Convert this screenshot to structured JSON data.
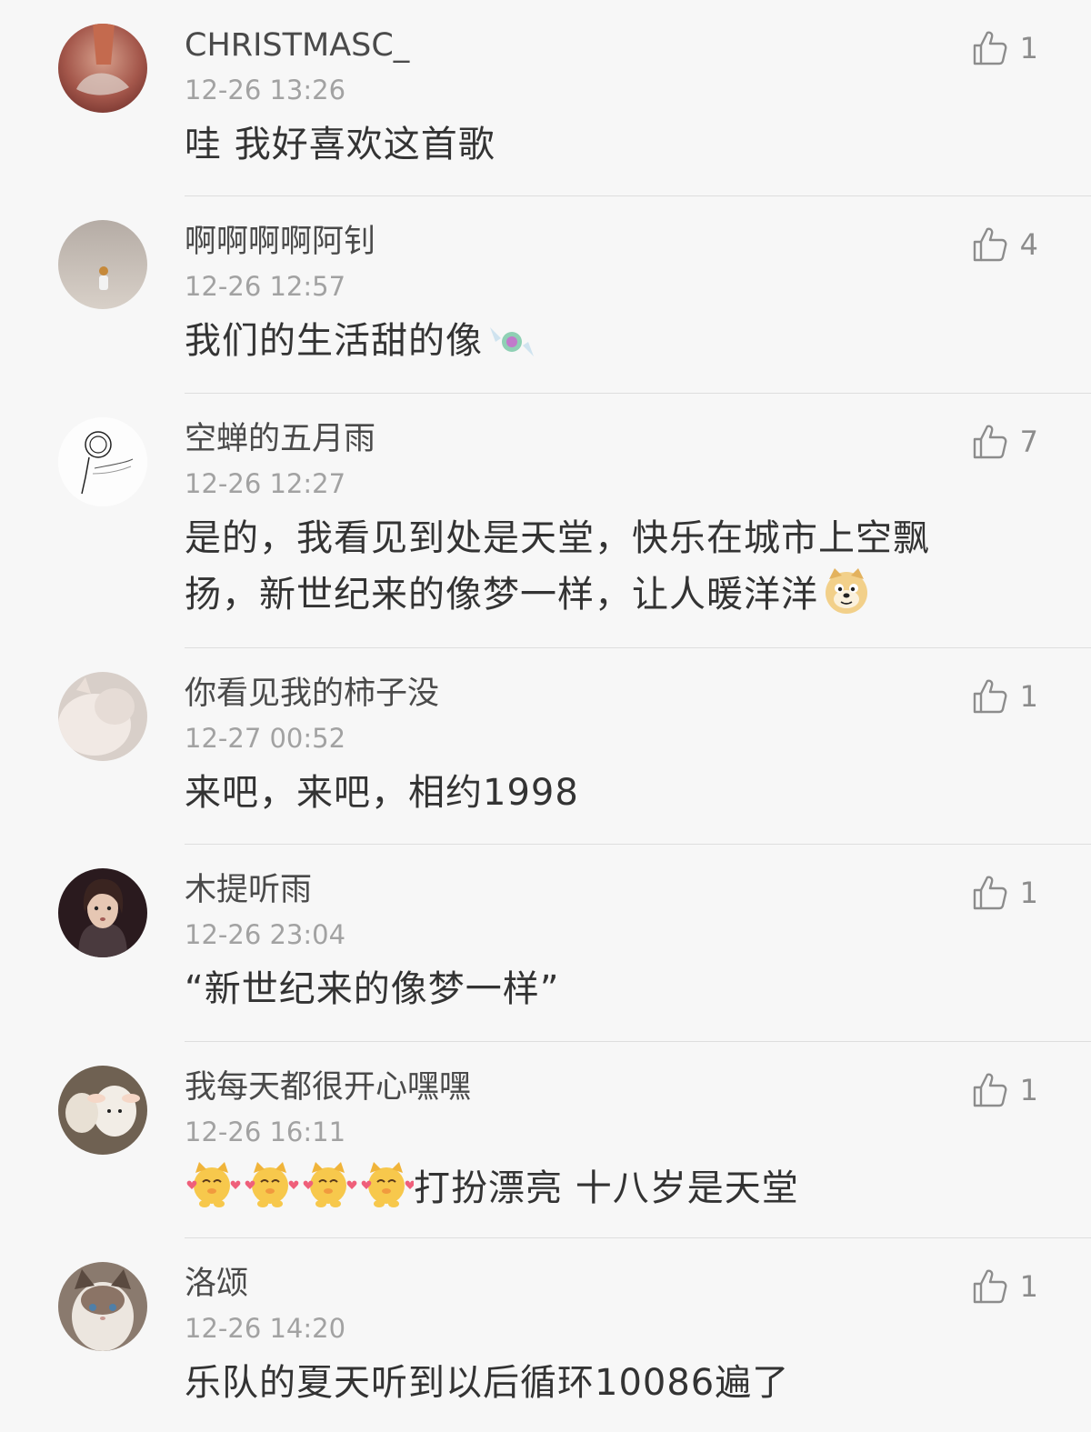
{
  "colors": {
    "background": "#f7f7f7",
    "username": "#4a4a4a",
    "timestamp": "#a2a2a2",
    "text": "#333333",
    "like": "#8c8c8c",
    "divider": "#dedede"
  },
  "comments": [
    {
      "username": "CHRISTMASC_",
      "timestamp": "12-26 13:26",
      "text": "哇 我好喜欢这首歌",
      "likes": "1",
      "like_icon": "thumbs-up-icon",
      "avatar": "avatar-hand-photo"
    },
    {
      "username": "啊啊啊啊阿钊",
      "timestamp": "12-26 12:57",
      "text": "我们的生活甜的像",
      "emoji": "candy-emoji",
      "likes": "4",
      "like_icon": "thumbs-up-icon",
      "avatar": "avatar-astronaut-photo"
    },
    {
      "username": "空蝉的五月雨",
      "timestamp": "12-26 12:27",
      "text_line1": "是的，我看见到处是天堂，快乐在城市上空飘",
      "text_line2": "扬，新世纪来的像梦一样，让人暖洋洋",
      "emoji": "doge-emoji",
      "likes": "7",
      "like_icon": "thumbs-up-icon",
      "avatar": "avatar-sketch-drawing"
    },
    {
      "username": "你看见我的柿子没",
      "timestamp": "12-27 00:52",
      "text": "来吧，来吧，相约1998",
      "likes": "1",
      "like_icon": "thumbs-up-icon",
      "avatar": "avatar-cat-photo"
    },
    {
      "username": "木提听雨",
      "timestamp": "12-26 23:04",
      "text": "“新世纪来的像梦一样”",
      "likes": "1",
      "like_icon": "thumbs-up-icon",
      "avatar": "avatar-person-photo"
    },
    {
      "username": "我每天都很开心嘿嘿",
      "timestamp": "12-26 16:11",
      "text": "打扮漂亮 十八岁是天堂",
      "emoji": "shiba-love-emoji",
      "likes": "1",
      "like_icon": "thumbs-up-icon",
      "avatar": "avatar-lamb-photo"
    },
    {
      "username": "洛颂",
      "timestamp": "12-26 14:20",
      "text": "乐队的夏天听到以后循环10086遍了",
      "likes": "1",
      "like_icon": "thumbs-up-icon",
      "avatar": "avatar-ragdoll-cat-photo"
    }
  ]
}
